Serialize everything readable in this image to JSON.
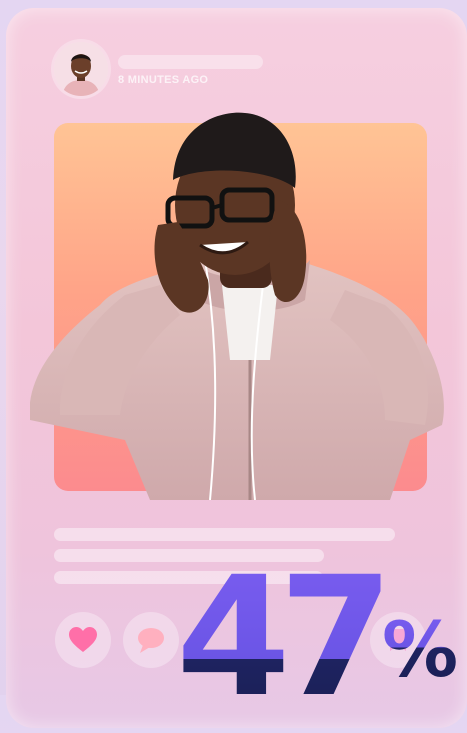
{
  "post": {
    "timestamp": "8 MINUTES AGO"
  },
  "stat": {
    "number": "47",
    "unit": "%"
  },
  "icons": {
    "like": "heart-icon",
    "comment": "chat-bubble-icon",
    "bookmark": "bookmark-icon"
  },
  "colors": {
    "accent": "#6c56e4",
    "accent_dark": "#1e2360",
    "photo_top": "#ffc495",
    "photo_bottom": "#fc8b8e",
    "heart": "#ff6fa8"
  }
}
